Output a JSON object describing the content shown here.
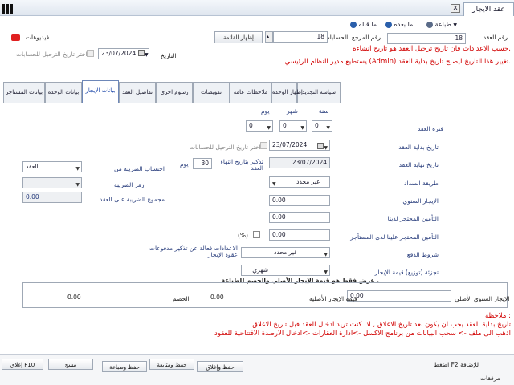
{
  "window": {
    "tab_title": "عقد الايجار",
    "close_glyph": "x"
  },
  "toolbar": {
    "print": "طباعة",
    "next": "ما بعده",
    "prev": "ما قبله"
  },
  "header": {
    "contract_no_label": "رقم العقد",
    "contract_no": "18",
    "ref_label": "رقم المرجع بالحسابات",
    "ref_value": "18",
    "show_list_button": "إظهار القائمة",
    "videos_label": "فيديوهات",
    "date_label": "التاريخ",
    "date_value": "23/07/2024",
    "choose_posting_date": "اختر تاريخ الترحيل للحسابات",
    "warn_line1": "حسب الاعدادات فان تاريخ ترحيل العقد هو تاريخ انشاءة.",
    "warn_line2": "يستطيع مدير النظام الرئيسي (Admin) تغيير هذا التاريخ ليصبح تاريخ بداية العقد."
  },
  "tabs": [
    "سياسة التجديد",
    "إظهار الوحدة",
    "ملاحظات عامة",
    "تفويضات",
    "رسوم اخرى",
    "تفاصيل العقد",
    "بيانات الإيجار",
    "بيانات الوحدة",
    "بيانات المستاجر"
  ],
  "contract": {
    "col_year": "سنة",
    "col_month": "شهر",
    "col_day": "يوم",
    "period_label": "فترة العقد",
    "years": "0",
    "months": "0",
    "days": "0",
    "start_label": "تاريخ بداية العقد",
    "start_value": "23/07/2024",
    "choose_posting_date": "اختر تاريخ الترحيل للحسابات",
    "end_label": "تاريخ نهاية العقد",
    "end_value": "23/07/2024",
    "remind_label": "تذكير بتاريخ انتهاء العقد",
    "remind_days": "30",
    "remind_unit": "يوم",
    "payment_method_label": "طريقة السداد",
    "payment_method": "غير محدد",
    "annual_rent_label": "الإيجار السنوي",
    "annual_rent": "0.00",
    "deposit_us_label": "التأمين المحتجز لدينا",
    "deposit_us": "0.00",
    "deposit_tenant_label": "التأمين المحتجز علينا لدى المستأجر",
    "deposit_tenant": "0.00",
    "percent_label": "(%)",
    "payment_terms_label": "شروط الدفع",
    "payment_terms": "غير محدد",
    "reminder_settings_label": "الاعدادات فعالة عن تذكير مدفوعات عقود الإيجار",
    "split_label": "تجزئة (توزيع) قيمة الإيجار",
    "split_value": "شهري"
  },
  "tax": {
    "calc_label": "احتساب الضريبة من",
    "calc_value": "العقد",
    "code_label": "رمز الضريبة",
    "total_label": "مجموع الضريبة على العقد",
    "total_value": "0.00"
  },
  "summary": {
    "title": "عرض فقط هو قيمة الإيجار الأصلي والخصم للطباعة .",
    "orig_annual_label": "الإيجار السنوي الأصلي",
    "orig_annual": "0.00",
    "orig_rent_label": "قيمة الإيجار الأصلية",
    "orig_rent": "0.00",
    "discount_label": "الخصم",
    "discount": "0.00"
  },
  "notes": {
    "title": "ملاحظة :",
    "line1": "تاريخ بداية العقد يجب ان يكون بعد تاريخ الاغلاق , اذا كنت تريد ادخال العقد قبل تاريخ الاغلاق",
    "line2": "اذهب الى ملف -> سحب البيانات من برنامج الاكسل ->ادارة العقارات ->ادخال الارصدة الافتتاحية للعقود"
  },
  "footer": {
    "save_close": "حفظ وإغلاق",
    "save_continue": "حفظ ومتابعة",
    "save_print": "حفظ وطباعة",
    "clear": "مسح",
    "close": "إغلاق F10",
    "add_hint": "اضغط F2 للإضافة",
    "attachments": "مرفقات"
  },
  "colors": {
    "accent_blue": "#253a7a",
    "warning_red": "#d10000",
    "tab_active_text": "#1a45a8"
  }
}
